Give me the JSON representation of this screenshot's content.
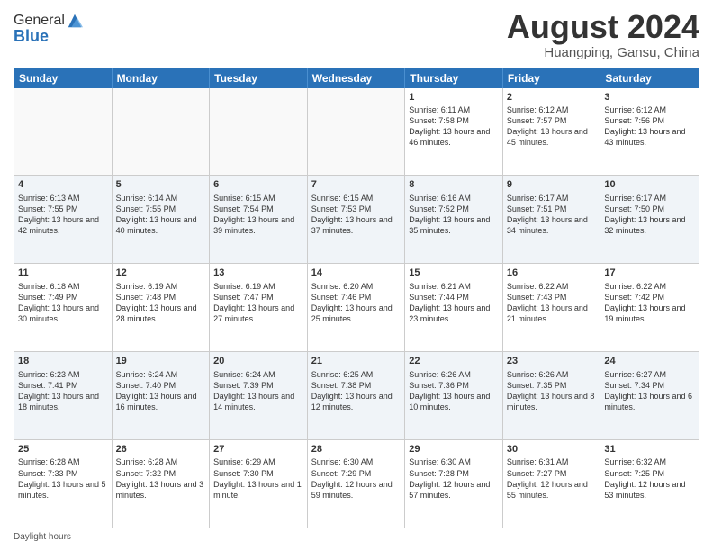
{
  "logo": {
    "general": "General",
    "blue": "Blue"
  },
  "title": "August 2024",
  "subtitle": "Huangping, Gansu, China",
  "days": [
    "Sunday",
    "Monday",
    "Tuesday",
    "Wednesday",
    "Thursday",
    "Friday",
    "Saturday"
  ],
  "rows": [
    [
      {
        "num": "",
        "info": ""
      },
      {
        "num": "",
        "info": ""
      },
      {
        "num": "",
        "info": ""
      },
      {
        "num": "",
        "info": ""
      },
      {
        "num": "1",
        "info": "Sunrise: 6:11 AM\nSunset: 7:58 PM\nDaylight: 13 hours and 46 minutes."
      },
      {
        "num": "2",
        "info": "Sunrise: 6:12 AM\nSunset: 7:57 PM\nDaylight: 13 hours and 45 minutes."
      },
      {
        "num": "3",
        "info": "Sunrise: 6:12 AM\nSunset: 7:56 PM\nDaylight: 13 hours and 43 minutes."
      }
    ],
    [
      {
        "num": "4",
        "info": "Sunrise: 6:13 AM\nSunset: 7:55 PM\nDaylight: 13 hours and 42 minutes."
      },
      {
        "num": "5",
        "info": "Sunrise: 6:14 AM\nSunset: 7:55 PM\nDaylight: 13 hours and 40 minutes."
      },
      {
        "num": "6",
        "info": "Sunrise: 6:15 AM\nSunset: 7:54 PM\nDaylight: 13 hours and 39 minutes."
      },
      {
        "num": "7",
        "info": "Sunrise: 6:15 AM\nSunset: 7:53 PM\nDaylight: 13 hours and 37 minutes."
      },
      {
        "num": "8",
        "info": "Sunrise: 6:16 AM\nSunset: 7:52 PM\nDaylight: 13 hours and 35 minutes."
      },
      {
        "num": "9",
        "info": "Sunrise: 6:17 AM\nSunset: 7:51 PM\nDaylight: 13 hours and 34 minutes."
      },
      {
        "num": "10",
        "info": "Sunrise: 6:17 AM\nSunset: 7:50 PM\nDaylight: 13 hours and 32 minutes."
      }
    ],
    [
      {
        "num": "11",
        "info": "Sunrise: 6:18 AM\nSunset: 7:49 PM\nDaylight: 13 hours and 30 minutes."
      },
      {
        "num": "12",
        "info": "Sunrise: 6:19 AM\nSunset: 7:48 PM\nDaylight: 13 hours and 28 minutes."
      },
      {
        "num": "13",
        "info": "Sunrise: 6:19 AM\nSunset: 7:47 PM\nDaylight: 13 hours and 27 minutes."
      },
      {
        "num": "14",
        "info": "Sunrise: 6:20 AM\nSunset: 7:46 PM\nDaylight: 13 hours and 25 minutes."
      },
      {
        "num": "15",
        "info": "Sunrise: 6:21 AM\nSunset: 7:44 PM\nDaylight: 13 hours and 23 minutes."
      },
      {
        "num": "16",
        "info": "Sunrise: 6:22 AM\nSunset: 7:43 PM\nDaylight: 13 hours and 21 minutes."
      },
      {
        "num": "17",
        "info": "Sunrise: 6:22 AM\nSunset: 7:42 PM\nDaylight: 13 hours and 19 minutes."
      }
    ],
    [
      {
        "num": "18",
        "info": "Sunrise: 6:23 AM\nSunset: 7:41 PM\nDaylight: 13 hours and 18 minutes."
      },
      {
        "num": "19",
        "info": "Sunrise: 6:24 AM\nSunset: 7:40 PM\nDaylight: 13 hours and 16 minutes."
      },
      {
        "num": "20",
        "info": "Sunrise: 6:24 AM\nSunset: 7:39 PM\nDaylight: 13 hours and 14 minutes."
      },
      {
        "num": "21",
        "info": "Sunrise: 6:25 AM\nSunset: 7:38 PM\nDaylight: 13 hours and 12 minutes."
      },
      {
        "num": "22",
        "info": "Sunrise: 6:26 AM\nSunset: 7:36 PM\nDaylight: 13 hours and 10 minutes."
      },
      {
        "num": "23",
        "info": "Sunrise: 6:26 AM\nSunset: 7:35 PM\nDaylight: 13 hours and 8 minutes."
      },
      {
        "num": "24",
        "info": "Sunrise: 6:27 AM\nSunset: 7:34 PM\nDaylight: 13 hours and 6 minutes."
      }
    ],
    [
      {
        "num": "25",
        "info": "Sunrise: 6:28 AM\nSunset: 7:33 PM\nDaylight: 13 hours and 5 minutes."
      },
      {
        "num": "26",
        "info": "Sunrise: 6:28 AM\nSunset: 7:32 PM\nDaylight: 13 hours and 3 minutes."
      },
      {
        "num": "27",
        "info": "Sunrise: 6:29 AM\nSunset: 7:30 PM\nDaylight: 13 hours and 1 minute."
      },
      {
        "num": "28",
        "info": "Sunrise: 6:30 AM\nSunset: 7:29 PM\nDaylight: 12 hours and 59 minutes."
      },
      {
        "num": "29",
        "info": "Sunrise: 6:30 AM\nSunset: 7:28 PM\nDaylight: 12 hours and 57 minutes."
      },
      {
        "num": "30",
        "info": "Sunrise: 6:31 AM\nSunset: 7:27 PM\nDaylight: 12 hours and 55 minutes."
      },
      {
        "num": "31",
        "info": "Sunrise: 6:32 AM\nSunset: 7:25 PM\nDaylight: 12 hours and 53 minutes."
      }
    ]
  ],
  "footer": {
    "daylight_label": "Daylight hours"
  }
}
